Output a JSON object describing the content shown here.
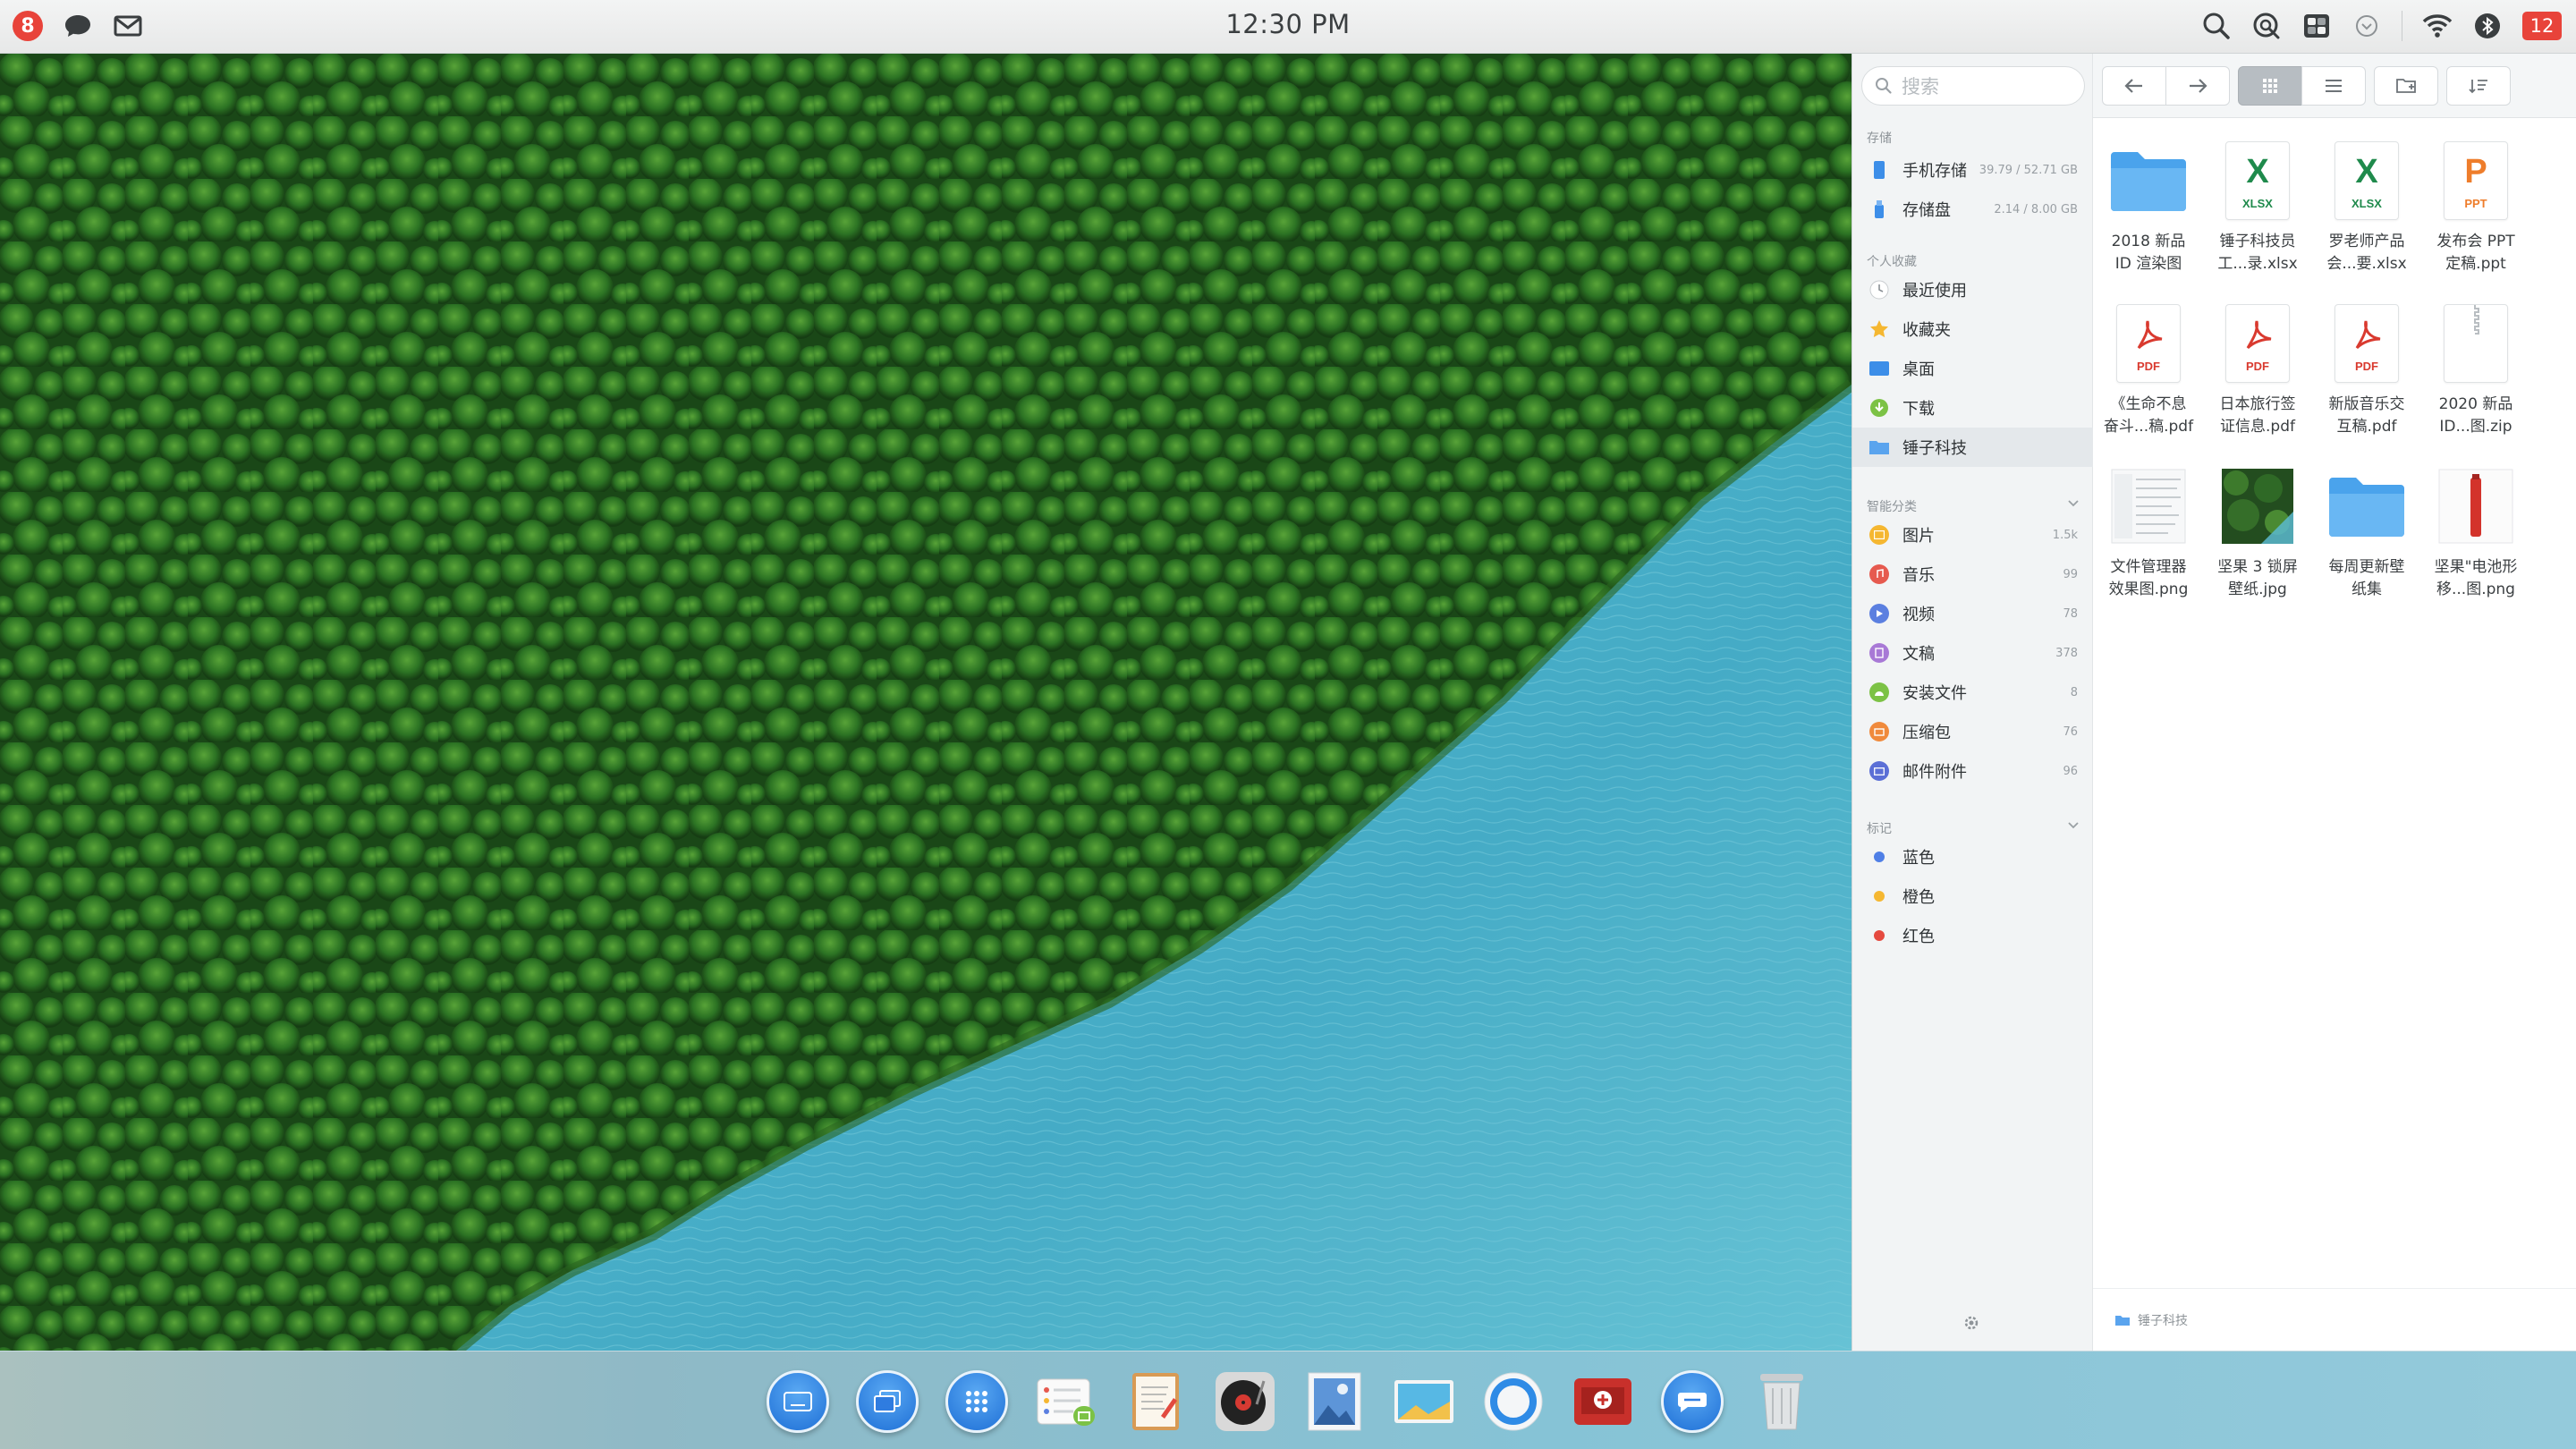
{
  "topbar": {
    "notification_count": "8",
    "clock": "12:30 PM",
    "unread_count": "12"
  },
  "sidebar": {
    "search_placeholder": "搜索",
    "storage_title": "存储",
    "storage": [
      {
        "label": "手机存储",
        "meta": "39.79 / 52.71 GB"
      },
      {
        "label": "存储盘",
        "meta": "2.14 / 8.00 GB"
      }
    ],
    "favorites_title": "个人收藏",
    "favorites": [
      {
        "label": "最近使用"
      },
      {
        "label": "收藏夹"
      },
      {
        "label": "桌面"
      },
      {
        "label": "下载"
      },
      {
        "label": "锤子科技"
      }
    ],
    "categories_title": "智能分类",
    "categories": [
      {
        "label": "图片",
        "count": "1.5k",
        "color": "#f5b731"
      },
      {
        "label": "音乐",
        "count": "99",
        "color": "#e65a4f"
      },
      {
        "label": "视频",
        "count": "78",
        "color": "#5b7fe0"
      },
      {
        "label": "文稿",
        "count": "378",
        "color": "#a879d6"
      },
      {
        "label": "安装文件",
        "count": "8",
        "color": "#7cc245"
      },
      {
        "label": "压缩包",
        "count": "76",
        "color": "#f08a3c"
      },
      {
        "label": "邮件附件",
        "count": "96",
        "color": "#5b6fd6"
      }
    ],
    "tags_title": "标记",
    "tags": [
      {
        "label": "蓝色",
        "color": "#4f7fe6"
      },
      {
        "label": "橙色",
        "color": "#f5b731"
      },
      {
        "label": "红色",
        "color": "#e54a3f"
      }
    ]
  },
  "files": [
    {
      "line1": "2018 新品",
      "line2": "ID 渲染图",
      "type": "folder"
    },
    {
      "line1": "锤子科技员",
      "line2": "工...录.xlsx",
      "type": "xlsx",
      "big": "X",
      "tag": "XLSX"
    },
    {
      "line1": "罗老师产品",
      "line2": "会...要.xlsx",
      "type": "xlsx",
      "big": "X",
      "tag": "XLSX"
    },
    {
      "line1": "发布会 PPT",
      "line2": "定稿.ppt",
      "type": "ppt",
      "big": "P",
      "tag": "PPT"
    },
    {
      "line1": "《生命不息",
      "line2": "奋斗...稿.pdf",
      "type": "pdf",
      "tag": "PDF"
    },
    {
      "line1": "日本旅行签",
      "line2": "证信息.pdf",
      "type": "pdf",
      "tag": "PDF"
    },
    {
      "line1": "新版音乐交",
      "line2": "互稿.pdf",
      "type": "pdf",
      "tag": "PDF"
    },
    {
      "line1": "2020 新品",
      "line2": "ID...图.zip",
      "type": "zip"
    },
    {
      "line1": "文件管理器",
      "line2": "效果图.png",
      "type": "png-screen"
    },
    {
      "line1": "坚果 3 锁屏",
      "line2": "壁纸.jpg",
      "type": "jpg-forest"
    },
    {
      "line1": "每周更新壁",
      "line2": "纸集",
      "type": "folder"
    },
    {
      "line1": "坚果\"电池形",
      "line2": "移...图.png",
      "type": "png-battery"
    }
  ],
  "status_path": "锤子科技",
  "dock": [
    "keyboard-icon",
    "windows-icon",
    "app-grid-icon",
    "settings-app-icon",
    "notes-app-icon",
    "music-app-icon",
    "photo-app-icon",
    "gallery-app-icon",
    "browser-app-icon",
    "mail-app-icon",
    "messages-app-icon",
    "trash-icon"
  ]
}
